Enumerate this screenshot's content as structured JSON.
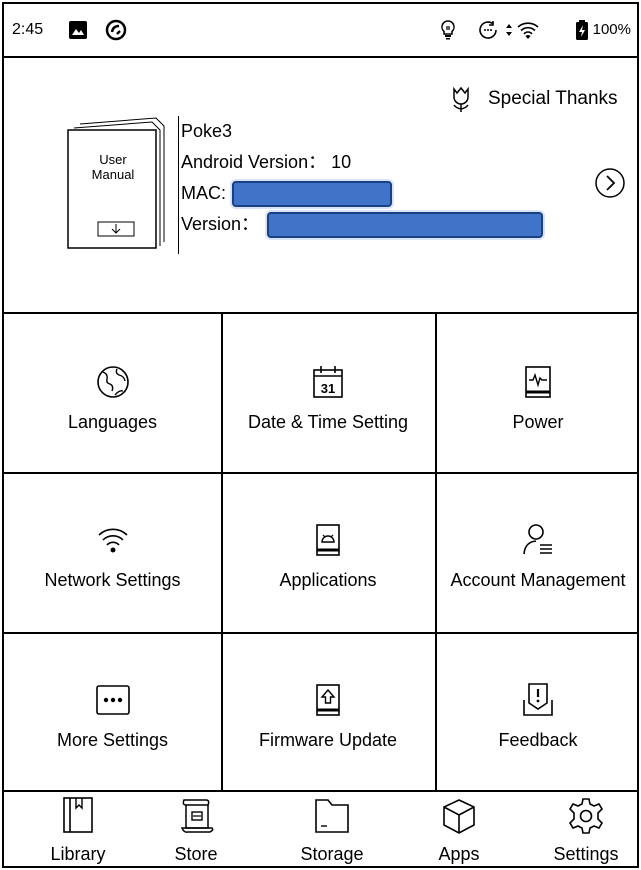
{
  "status_bar": {
    "time": "2:45",
    "battery_percent": "100%",
    "icons": [
      "image-icon",
      "sync-icon",
      "frontlight-icon",
      "refresh-icon",
      "wifi-icon",
      "battery-icon"
    ]
  },
  "info": {
    "special_thanks": "Special Thanks",
    "manual_label": "User Manual",
    "device_name": "Poke3",
    "android_version": "Android Version： 10",
    "mac_label": "MAC:",
    "version_label": "Version："
  },
  "grid": {
    "items": [
      {
        "label": "Languages",
        "icon": "globe-icon"
      },
      {
        "label": "Date & Time Setting",
        "icon": "calendar-icon",
        "day": "31"
      },
      {
        "label": "Power",
        "icon": "power-monitor-icon"
      },
      {
        "label": "Network Settings",
        "icon": "wifi-icon"
      },
      {
        "label": "Applications",
        "icon": "android-app-icon"
      },
      {
        "label": "Account Management",
        "icon": "account-icon"
      },
      {
        "label": "More Settings",
        "icon": "more-icon"
      },
      {
        "label": "Firmware Update",
        "icon": "firmware-update-icon"
      },
      {
        "label": "Feedback",
        "icon": "feedback-icon"
      }
    ]
  },
  "nav": {
    "items": [
      {
        "label": "Library",
        "icon": "library-icon"
      },
      {
        "label": "Store",
        "icon": "store-icon"
      },
      {
        "label": "Storage",
        "icon": "folder-icon"
      },
      {
        "label": "Apps",
        "icon": "cube-icon"
      },
      {
        "label": "Settings",
        "icon": "gear-icon"
      }
    ],
    "active": "Settings"
  },
  "colors": {
    "redaction_fill": "#3f74c9",
    "text": "#000000",
    "background": "#ffffff"
  }
}
